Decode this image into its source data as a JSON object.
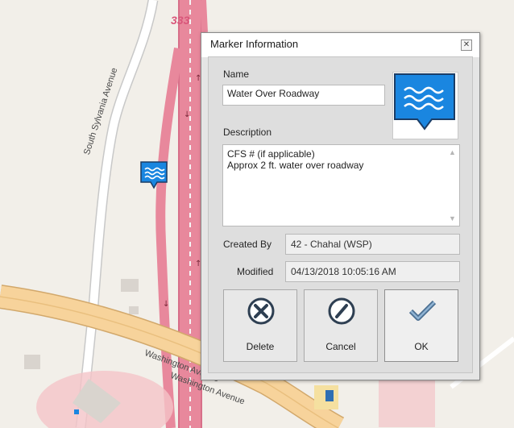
{
  "map": {
    "route_shield": "333",
    "streets": [
      {
        "name": "South Sylvania Avenue"
      },
      {
        "name": "Washington Avenue"
      },
      {
        "name": "Washington Avenue"
      }
    ],
    "colors": {
      "background": "#f2efe9",
      "highway": "#e8889c",
      "road": "#ffffff",
      "arterial": "#f7d39b",
      "marker": "#1a86e0"
    }
  },
  "dialog": {
    "title": "Marker Information",
    "close_icon": "close-icon",
    "name_label": "Name",
    "name_value": "Water Over Roadway",
    "description_label": "Description",
    "description_lines": [
      "CFS # (if applicable)",
      "Approx 2 ft. water over roadway"
    ],
    "created_by_label": "Created By",
    "created_by_value": "42 - Chahal (WSP)",
    "modified_label": "Modified",
    "modified_value": "04/13/2018 10:05:16 AM",
    "marker_icon": "water-waves-icon",
    "buttons": {
      "delete": {
        "label": "Delete",
        "icon": "delete-x-icon"
      },
      "cancel": {
        "label": "Cancel",
        "icon": "cancel-slash-icon"
      },
      "ok": {
        "label": "OK",
        "icon": "checkmark-icon"
      }
    }
  }
}
